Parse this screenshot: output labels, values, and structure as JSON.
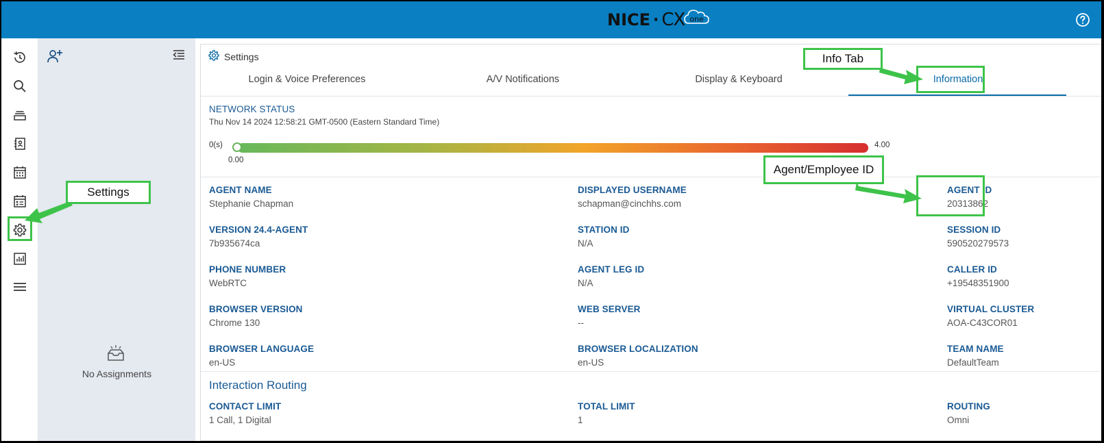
{
  "app": {
    "logo_nice": "NICE",
    "logo_cx": "CX",
    "logo_one": "one",
    "icons": [
      "history-icon",
      "search-icon",
      "queue-icon",
      "contacts-icon",
      "calendar-icon",
      "schedule-icon",
      "gear-icon",
      "reports-icon",
      "menu-icon",
      "help-icon"
    ]
  },
  "assignments": {
    "empty_text": "No Assignments"
  },
  "settings": {
    "title": "Settings",
    "tabs": [
      {
        "label": "Login & Voice Preferences"
      },
      {
        "label": "A/V Notifications"
      },
      {
        "label": "Display & Keyboard"
      },
      {
        "label": "Information",
        "active": true
      }
    ]
  },
  "network": {
    "title": "NETWORK STATUS",
    "timestamp": "Thu Nov 14 2024 12:58:21 GMT-0500 (Eastern Standard Time)",
    "min_label": "0(s)",
    "max_label": "4.00",
    "current_label": "0.00",
    "value": 0.0,
    "max": 4.0
  },
  "info": {
    "rows": [
      [
        {
          "label": "AGENT NAME",
          "value": "Stephanie Chapman"
        },
        {
          "label": "DISPLAYED USERNAME",
          "value": "schapman@cinchhs.com"
        },
        {
          "label": "AGENT ID",
          "value": "20313862"
        }
      ],
      [
        {
          "label": "VERSION 24.4-AGENT",
          "value": "7b935674ca"
        },
        {
          "label": "STATION ID",
          "value": "N/A"
        },
        {
          "label": "SESSION ID",
          "value": "590520279573"
        }
      ],
      [
        {
          "label": "PHONE NUMBER",
          "value": "WebRTC"
        },
        {
          "label": "AGENT LEG ID",
          "value": "N/A"
        },
        {
          "label": "CALLER ID",
          "value": "+19548351900"
        }
      ],
      [
        {
          "label": "BROWSER VERSION",
          "value": "Chrome 130"
        },
        {
          "label": "WEB SERVER",
          "value": "--"
        },
        {
          "label": "VIRTUAL CLUSTER",
          "value": "AOA-C43COR01"
        }
      ],
      [
        {
          "label": "BROWSER LANGUAGE",
          "value": "en-US"
        },
        {
          "label": "BROWSER LOCALIZATION",
          "value": "en-US"
        },
        {
          "label": "TEAM NAME",
          "value": "DefaultTeam"
        }
      ]
    ]
  },
  "routing": {
    "title": "Interaction Routing",
    "fields": [
      {
        "label": "CONTACT LIMIT",
        "value": "1 Call, 1 Digital"
      },
      {
        "label": "TOTAL LIMIT",
        "value": "1"
      },
      {
        "label": "ROUTING",
        "value": "Omni"
      }
    ]
  },
  "annotations": {
    "settings": "Settings",
    "info_tab": "Info Tab",
    "agent_id": "Agent/Employee ID",
    "color": "#3ec34a"
  }
}
